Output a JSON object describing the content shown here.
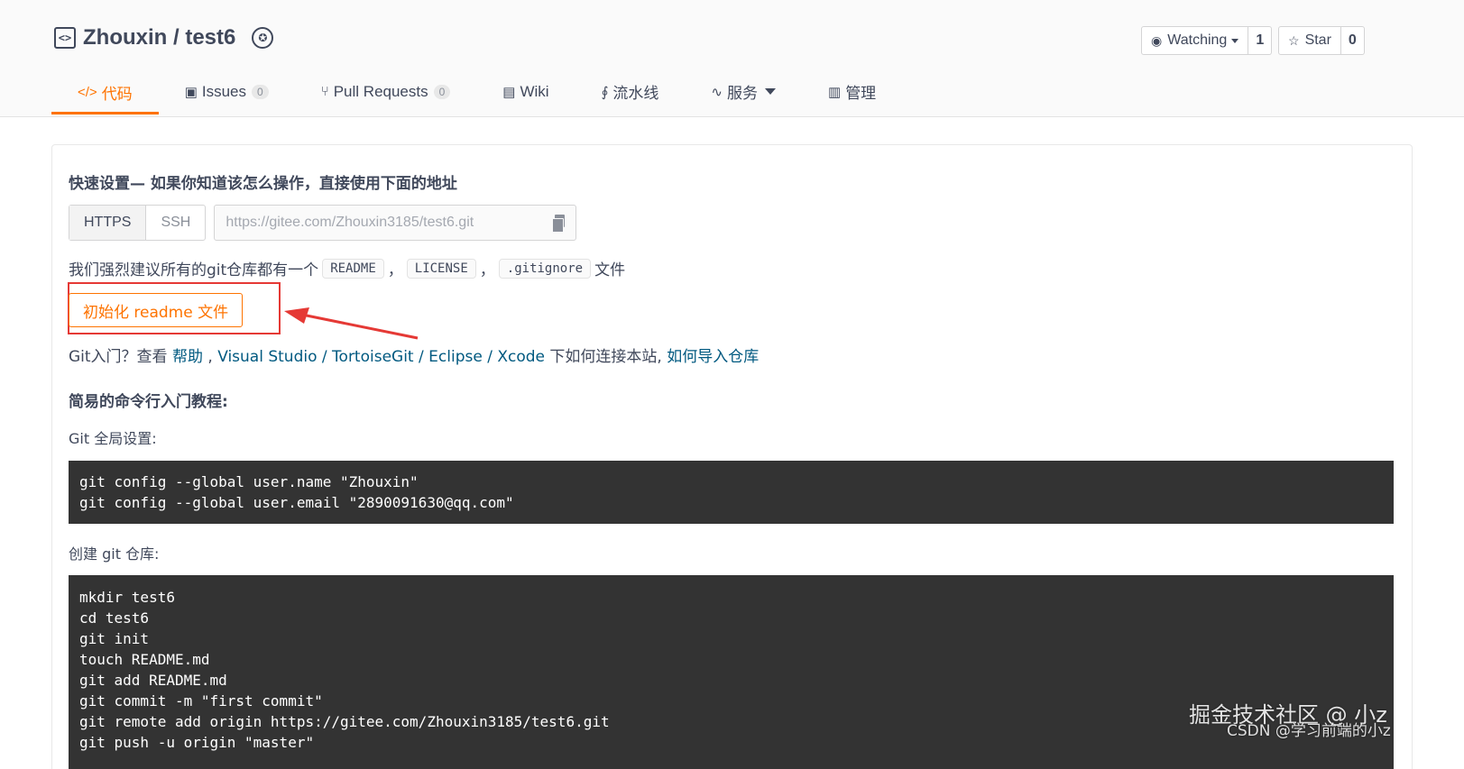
{
  "repo": {
    "owner": "Zhouxin",
    "separator": " / ",
    "name": "test6"
  },
  "social": {
    "watch_label": "Watching",
    "watch_count": "1",
    "star_label": "Star",
    "star_count": "0"
  },
  "tabs": [
    {
      "label": "代码",
      "count": null
    },
    {
      "label": "Issues",
      "count": "0"
    },
    {
      "label": "Pull Requests",
      "count": "0"
    },
    {
      "label": "Wiki",
      "count": null
    },
    {
      "label": "流水线",
      "count": null
    },
    {
      "label": "服务",
      "count": null
    },
    {
      "label": "管理",
      "count": null
    }
  ],
  "quick_setup": {
    "title": "快速设置— 如果你知道该怎么操作，直接使用下面的地址",
    "https_label": "HTTPS",
    "ssh_label": "SSH",
    "url": "https://gitee.com/Zhouxin3185/test6.git"
  },
  "recommend": {
    "prefix": "我们强烈建议所有的git仓库都有一个",
    "readme": "README",
    "license": "LICENSE",
    "gitignore": ".gitignore",
    "comma": "，",
    "suffix": "文件"
  },
  "init_button": "初始化 readme 文件",
  "help": {
    "prefix": "Git入门？查看 ",
    "help_link": "帮助",
    "sep1": " , ",
    "vs_link": "Visual Studio",
    "slash": " / ",
    "tortoise_link": "TortoiseGit",
    "eclipse_link": "Eclipse",
    "xcode_link": "Xcode",
    "middle": " 下如何连接本站, ",
    "import_link": "如何导入仓库"
  },
  "tutorial": {
    "title": "简易的命令行入门教程:",
    "global_label": "Git 全局设置:",
    "global_code": "git config --global user.name \"Zhouxin\"\ngit config --global user.email \"2890091630@qq.com\"",
    "create_label": "创建 git 仓库:",
    "create_code": "mkdir test6\ncd test6\ngit init\ntouch README.md\ngit add README.md\ngit commit -m \"first commit\"\ngit remote add origin https://gitee.com/Zhouxin3185/test6.git\ngit push -u origin \"master\""
  },
  "watermark": {
    "line1": "掘金技术社区 @ 小z",
    "line2": "CSDN @学习前端的小z"
  },
  "colors": {
    "accent": "#fe7300",
    "link": "#005980",
    "highlight_border": "#e53935",
    "code_bg": "#333333"
  }
}
